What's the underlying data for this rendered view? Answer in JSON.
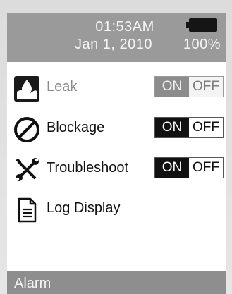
{
  "status": {
    "time": "01:53AM",
    "date": "Jan 1, 2010",
    "battery_percent": "100%",
    "battery_level": 1.0
  },
  "menu": {
    "items": [
      {
        "label": "Leak",
        "icon": "water-drop-icon",
        "on_label": "ON",
        "off_label": "OFF",
        "state": "on",
        "enabled": false
      },
      {
        "label": "Blockage",
        "icon": "no-entry-icon",
        "on_label": "ON",
        "off_label": "OFF",
        "state": "on",
        "enabled": true
      },
      {
        "label": "Troubleshoot",
        "icon": "tools-icon",
        "on_label": "ON",
        "off_label": "OFF",
        "state": "on",
        "enabled": true
      },
      {
        "label": "Log Display",
        "icon": "document-icon"
      }
    ]
  },
  "footer": {
    "title": "Alarm"
  },
  "colors": {
    "header_bg": "#9a9a9a",
    "footer_bg": "#8e8e8e",
    "active_bg": "#111111",
    "screen_bg": "#ffffff"
  }
}
